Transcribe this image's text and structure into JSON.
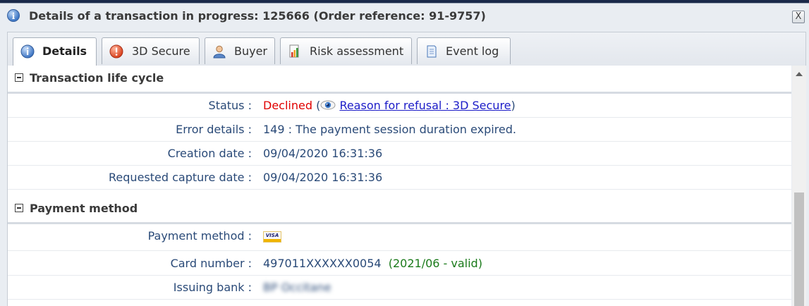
{
  "dialog": {
    "title": "Details of a transaction in progress: 125666 (Order reference: 91-9757)",
    "close_label": "X"
  },
  "tabs": [
    {
      "label": "Details",
      "icon": "info-icon",
      "active": true
    },
    {
      "label": "3D Secure",
      "icon": "warning-icon",
      "active": false
    },
    {
      "label": "Buyer",
      "icon": "user-icon",
      "active": false
    },
    {
      "label": "Risk assessment",
      "icon": "risk-chart-icon",
      "active": false
    },
    {
      "label": "Event log",
      "icon": "log-page-icon",
      "active": false
    }
  ],
  "lifecycle": {
    "title": "Transaction life cycle",
    "status_label": "Status :",
    "status_value": "Declined",
    "open_paren": "(",
    "close_paren": ")",
    "reason_link": "Reason for refusal : 3D Secure",
    "error_label": "Error details :",
    "error_value": "149 : The payment session duration expired.",
    "creation_label": "Creation date :",
    "creation_value": "09/04/2020 16:31:36",
    "capture_label": "Requested capture date :",
    "capture_value": "09/04/2020 16:31:36"
  },
  "payment": {
    "title": "Payment method",
    "method_label": "Payment method :",
    "method_card_text": "VISA",
    "card_label": "Card number :",
    "card_value": "497011XXXXXX0054",
    "expiry_value": "(2021/06 - valid)",
    "bank_label": "Issuing bank :",
    "bank_value": "BP Occitane"
  },
  "colors": {
    "declined": "#e00000",
    "link": "#1c1cc8",
    "valid": "#1a7a1a",
    "label": "#2a4a78"
  }
}
